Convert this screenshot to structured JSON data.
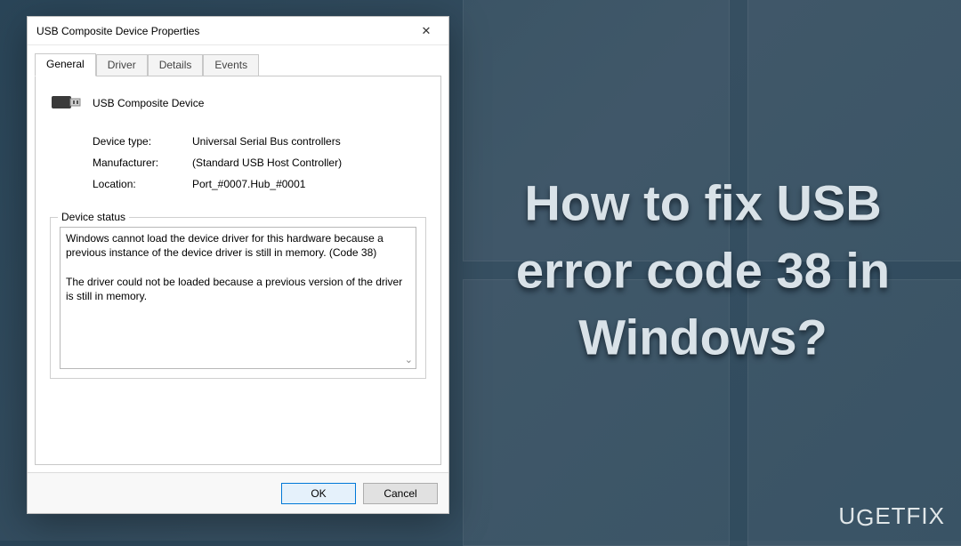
{
  "headline": "How to fix USB error code 38 in Windows?",
  "watermark": "UGETFIX",
  "dialog": {
    "title": "USB Composite Device Properties",
    "close_glyph": "✕",
    "tabs": [
      {
        "label": "General",
        "active": true
      },
      {
        "label": "Driver",
        "active": false
      },
      {
        "label": "Details",
        "active": false
      },
      {
        "label": "Events",
        "active": false
      }
    ],
    "device_name": "USB Composite Device",
    "info": {
      "device_type_label": "Device type:",
      "device_type_value": "Universal Serial Bus controllers",
      "manufacturer_label": "Manufacturer:",
      "manufacturer_value": "(Standard USB Host Controller)",
      "location_label": "Location:",
      "location_value": "Port_#0007.Hub_#0001"
    },
    "status_legend": "Device status",
    "status_text": "Windows cannot load the device driver for this hardware because a previous instance of the device driver is still in memory. (Code 38)\n\nThe driver could not be loaded because a previous version of the driver is still in memory.",
    "buttons": {
      "ok": "OK",
      "cancel": "Cancel"
    }
  }
}
